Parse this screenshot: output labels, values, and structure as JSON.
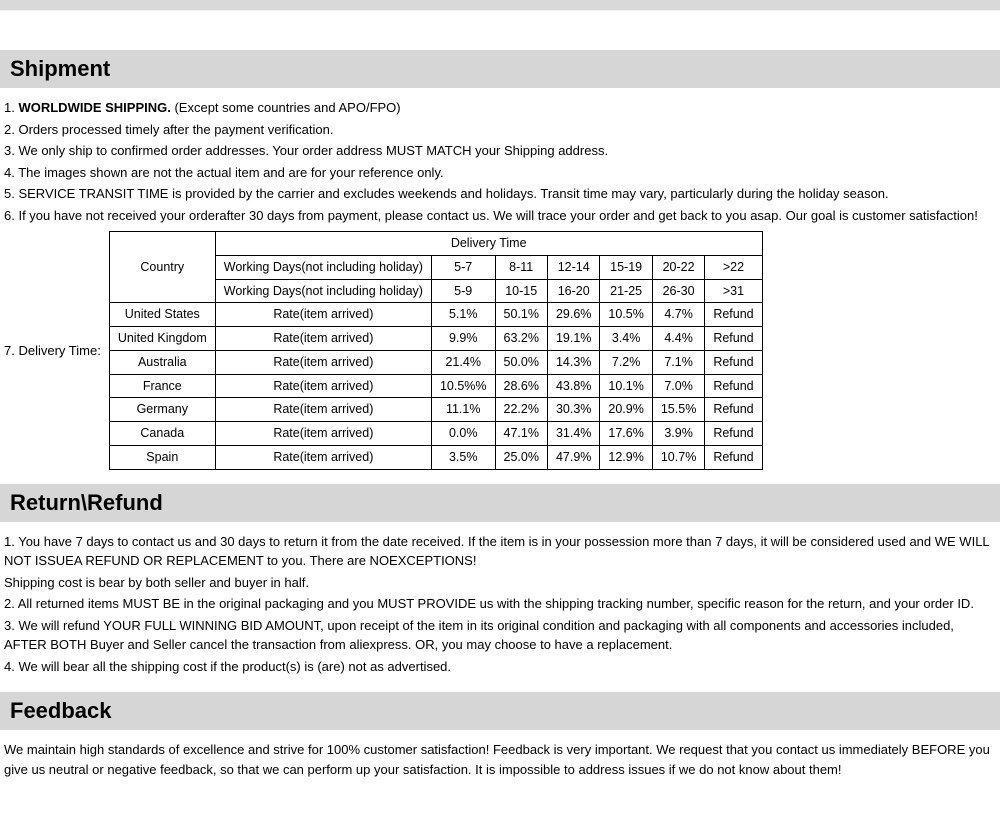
{
  "headings": {
    "shipment": "Shipment",
    "return": "Return\\Refund",
    "feedback": "Feedback"
  },
  "shipment": {
    "l1a": "1. ",
    "l1b": "WORLDWIDE SHIPPING.",
    "l1c": " (Except some countries and APO/FPO)",
    "l2": "2. Orders processed timely after the payment verification.",
    "l3": "3. We only ship to confirmed order addresses. Your order address MUST MATCH your Shipping address.",
    "l4": "4. The images shown are not the actual item and are for your reference only.",
    "l5": "5. SERVICE TRANSIT TIME is provided by the carrier and excludes weekends and holidays. Transit time may vary, particularly during the holiday season.",
    "l6": "6. If you have not received your orderafter 30 days from payment, please contact us. We will trace your order and get back to   you asap. Our goal is customer satisfaction!",
    "l7label": "7. Delivery Time:"
  },
  "table": {
    "country_hdr": "Country",
    "delivery_hdr": "Delivery Time",
    "wd1": "Working Days(not including holiday)",
    "wd2": "Working Days(not including holiday)",
    "rate_label": "Rate(item arrived)",
    "refund": "Refund",
    "ranges1": [
      "5-7",
      "8-11",
      "12-14",
      "15-19",
      "20-22",
      ">22"
    ],
    "ranges2": [
      "5-9",
      "10-15",
      "16-20",
      "21-25",
      "26-30",
      ">31"
    ],
    "rows": [
      {
        "c": "United States",
        "v": [
          "5.1%",
          "50.1%",
          "29.6%",
          "10.5%",
          "4.7%"
        ]
      },
      {
        "c": "United Kingdom",
        "v": [
          "9.9%",
          "63.2%",
          "19.1%",
          "3.4%",
          "4.4%"
        ]
      },
      {
        "c": "Australia",
        "v": [
          "21.4%",
          "50.0%",
          "14.3%",
          "7.2%",
          "7.1%"
        ]
      },
      {
        "c": "France",
        "v": [
          "10.5%%",
          "28.6%",
          "43.8%",
          "10.1%",
          "7.0%"
        ]
      },
      {
        "c": "Germany",
        "v": [
          "11.1%",
          "22.2%",
          "30.3%",
          "20.9%",
          "15.5%"
        ]
      },
      {
        "c": "Canada",
        "v": [
          "0.0%",
          "47.1%",
          "31.4%",
          "17.6%",
          "3.9%"
        ]
      },
      {
        "c": "Spain",
        "v": [
          "3.5%",
          "25.0%",
          "47.9%",
          "12.9%",
          "10.7%"
        ]
      }
    ]
  },
  "return": {
    "p1": "1. You have 7 days to contact us and 30 days to return it from the date received. If the item is in your possession more than 7 days, it will be considered used and WE WILL NOT ISSUEA REFUND OR REPLACEMENT to you. There are NOEXCEPTIONS!",
    "p1b": "Shipping cost is bear by both seller and buyer in half.",
    "p2": "2. All returned items MUST BE in the original packaging and you MUST PROVIDE us with the shipping tracking number, specific reason for the return, and your order ID.",
    "p3": "3. We will refund YOUR FULL WINNING BID AMOUNT, upon receipt of the item in its original condition and packaging with all components and accessories included, AFTER BOTH Buyer and Seller cancel the transaction from aliexpress. OR, you may choose to have a replacement.",
    "p4": "4. We will bear all the shipping cost if the product(s) is (are) not as advertised."
  },
  "feedback": {
    "p1": "We maintain high standards of excellence and strive for 100% customer satisfaction! Feedback is very important. We request that you contact us immediately BEFORE you give us neutral or negative feedback, so that we can perform up your satisfaction. It is impossible to address issues if we do not know about them!"
  }
}
